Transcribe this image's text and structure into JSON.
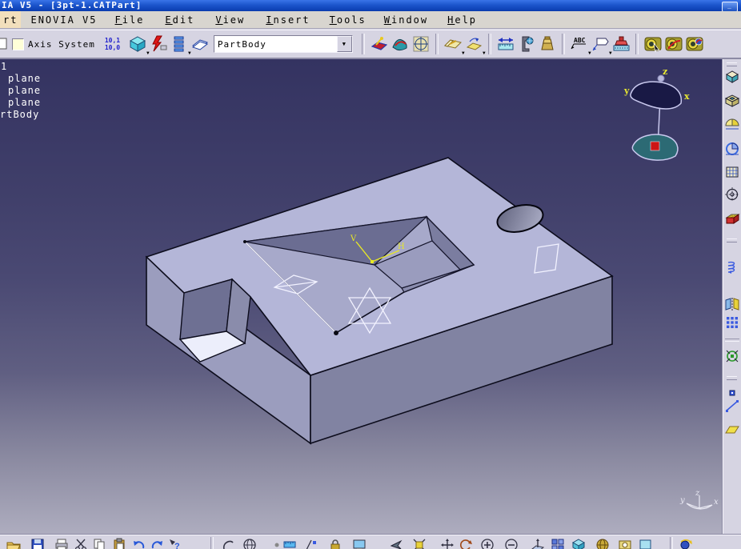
{
  "window": {
    "title": "IA V5 - [3pt-1.CATPart]",
    "minimize_label": "_"
  },
  "menubar": {
    "items": [
      {
        "label": "rt",
        "highlighted": true
      },
      {
        "label": "ENOVIA V5"
      },
      {
        "label": "File"
      },
      {
        "label": "Edit"
      },
      {
        "label": "View"
      },
      {
        "label": "Insert"
      },
      {
        "label": "Tools"
      },
      {
        "label": "Window"
      },
      {
        "label": "Help"
      }
    ]
  },
  "toolbar": {
    "axis_system_label": "Axis System",
    "units_line1": "10,1",
    "units_line2": "10,0",
    "partbody_value": "PartBody",
    "icons": [
      "axis-system-checkbox",
      "units-display",
      "isometric-view",
      "update",
      "specification-list",
      "catalog-browser",
      "partbody-combobox",
      "sketcher",
      "surfaces",
      "generative-shape",
      "plane-note",
      "plane-note-arrow",
      "measure-between",
      "measure-item",
      "mass-properties",
      "text-annotation",
      "flag-note",
      "stamp",
      "render-tool-1",
      "render-tool-2",
      "render-tool-3"
    ]
  },
  "tree": {
    "items": [
      "1",
      "plane",
      "plane",
      "plane",
      "rtBody"
    ]
  },
  "viewport": {
    "sketch_axis": {
      "v_label": "V",
      "h_label": "H"
    },
    "compass": {
      "x": "x",
      "y": "y",
      "z": "z"
    },
    "axis_triad": {
      "x": "x",
      "y": "y",
      "z": "z"
    }
  },
  "right_toolbar": {
    "icons": [
      "pad",
      "pocket",
      "shaft",
      "groove",
      "hole",
      "circular-reference",
      "rib",
      "helix",
      "mirror",
      "rectangular-pattern",
      "scaling",
      "point",
      "line",
      "plane"
    ]
  },
  "bottom_toolbar": {
    "icons": [
      "open",
      "save",
      "print",
      "cut",
      "copy",
      "paste",
      "undo",
      "redo",
      "context-help",
      "wireframe",
      "globe",
      "dot",
      "ruler",
      "axis-snap",
      "lock",
      "screen",
      "fly-mode",
      "fit-all-in",
      "pan",
      "rotate",
      "zoom-in",
      "zoom-out",
      "normal-view",
      "multi-view",
      "iso-view",
      "render-style",
      "hide-show",
      "magnifier",
      "turntable"
    ]
  },
  "colors": {
    "titlebar": "#1c55cc",
    "toolbar_bg": "#d6d4e2",
    "menu_bg": "#d8d5cf",
    "menu_highlight": "#f2dfbc",
    "viewport_top": "#343361",
    "viewport_bottom": "#aeadbf",
    "part_top_face": "#b4b6d8",
    "part_right_face": "#8183a2",
    "part_left_face": "#9b9dbe",
    "notch_back_wall": "#6e7093",
    "notch_floor": "#eceefb",
    "pocket_wall": "#6b6d92",
    "pocket_floor": "#9a9cbe",
    "sketch_white": "#f2f2ff",
    "axis_yellow": "#e8e825",
    "compass_navy": "#191945",
    "compass_teal": "#2c6a74",
    "compass_handle_red": "#cc1515"
  }
}
